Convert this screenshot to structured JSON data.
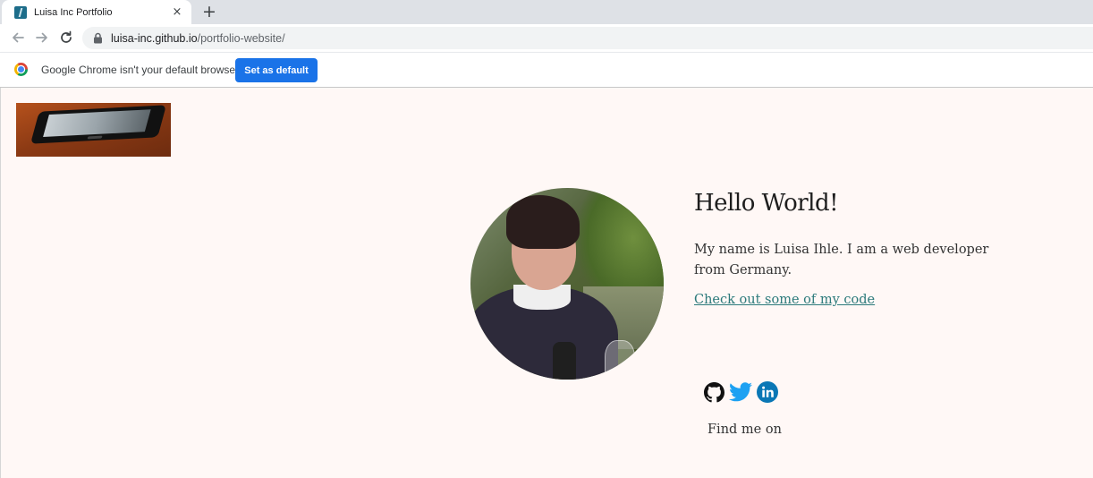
{
  "browser": {
    "tab": {
      "title": "Luisa Inc Portfolio"
    },
    "icons": {
      "tab_close": "×",
      "new_tab": "+"
    },
    "address_bar": {
      "host": "luisa-inc.github.io",
      "path": "/portfolio-website/"
    },
    "infobar": {
      "message": "Google Chrome isn't your default browser",
      "button_label": "Set as default"
    }
  },
  "page": {
    "heading": "Hello World!",
    "intro": "My name is Luisa Ihle. I am a web developer from Germany.",
    "code_link": "Check out some of my code",
    "social_icons": [
      "github-icon",
      "twitter-icon",
      "linkedin-icon"
    ],
    "find_me_label": "Find me on",
    "colors": {
      "background": "#fff8f6",
      "link": "#2c7a7b",
      "twitter": "#1da1f2",
      "linkedin": "#0a77b5",
      "infobar_button": "#1a73e8"
    }
  }
}
